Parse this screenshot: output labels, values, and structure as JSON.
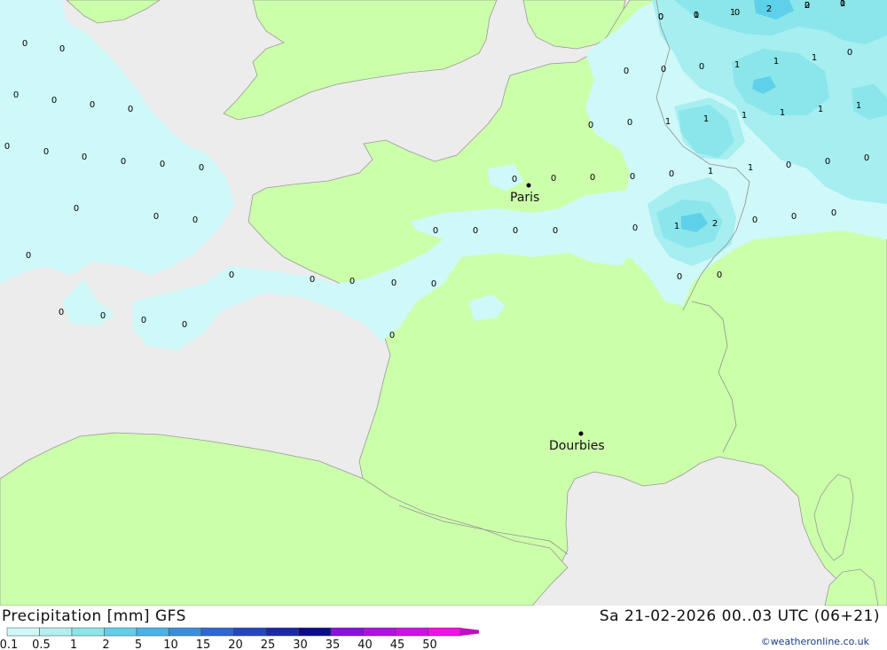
{
  "header": {
    "title": "Precipitation [mm] GFS",
    "timestamp": "Sa 21-02-2026 00..03 UTC (06+21)",
    "credit": "©weatheronline.co.uk"
  },
  "cities": [
    {
      "name": "Paris"
    },
    {
      "name": "Dourbies"
    }
  ],
  "legend": {
    "ticks": [
      "0.1",
      "0.5",
      "1",
      "2",
      "5",
      "10",
      "15",
      "20",
      "25",
      "30",
      "35",
      "40",
      "45",
      "50"
    ],
    "colors": [
      "#cff8f8",
      "#b2f0f0",
      "#8ae6ea",
      "#5ed0ea",
      "#46b4e8",
      "#3a8ee0",
      "#2e66d4",
      "#2446c0",
      "#1a2aa8",
      "#0c0c8a",
      "#8a10e0",
      "#b010e6",
      "#d010ea",
      "#f010ea",
      "#c010c0"
    ]
  },
  "colors": {
    "sea": "#ececec",
    "land": "#ccffaa",
    "border": "#a0a0a0"
  },
  "precip_values": [
    "0",
    "0",
    "0",
    "0",
    "0",
    "0",
    "0",
    "0",
    "0",
    "0",
    "0",
    "0",
    "0",
    "0",
    "0",
    "0",
    "0",
    "0",
    "0",
    "0",
    "0",
    "0",
    "0",
    "0",
    "0",
    "0",
    "0",
    "0",
    "0",
    "0",
    "0",
    "0",
    "0",
    "0",
    "0",
    "0",
    "0",
    "0",
    "0",
    "0",
    "0",
    "0",
    "0",
    "0",
    "0",
    "0",
    "0",
    "0",
    "0",
    "0",
    "0",
    "0",
    "0",
    "0",
    "0",
    "0",
    "1",
    "1",
    "2",
    "2",
    "1",
    "1",
    "1",
    "1",
    "1",
    "1",
    "1",
    "1",
    "1",
    "1",
    "1",
    "1",
    "1",
    "2",
    "2"
  ]
}
